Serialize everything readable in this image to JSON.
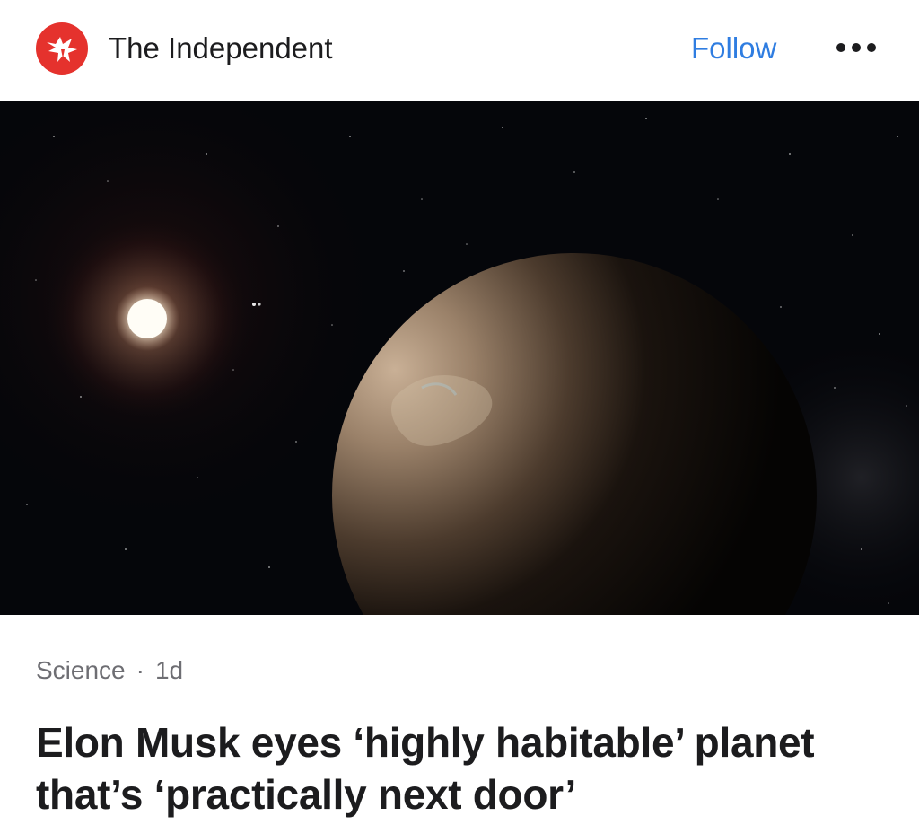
{
  "header": {
    "publisher_name": "The Independent",
    "logo_icon": "eagle-logo-icon",
    "follow_label": "Follow",
    "more_icon": "more-horizontal-icon"
  },
  "article": {
    "image_description_icon": "planet-image",
    "category": "Science",
    "separator": "·",
    "age": "1d",
    "headline": "Elon Musk eyes ‘highly habitable’ planet that’s ‘practically next door’"
  },
  "colors": {
    "brand": "#e5322d",
    "accent": "#2f7de1",
    "text": "#1c1c1e",
    "secondary": "#6e6e73"
  }
}
